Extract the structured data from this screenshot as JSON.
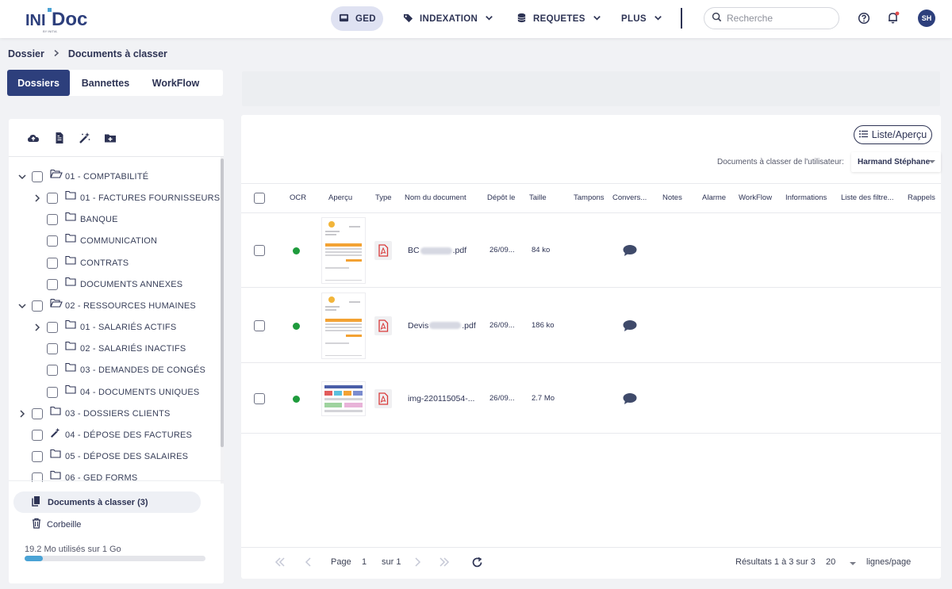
{
  "app": {
    "logo_text": "INITDoc",
    "logo_sub": "BY INITIA"
  },
  "nav": {
    "items": [
      {
        "label": "GED",
        "icon": "tray-icon",
        "active": true
      },
      {
        "label": "INDEXATION",
        "icon": "tag-icon",
        "active": false
      },
      {
        "label": "REQUETES",
        "icon": "database-icon",
        "active": false
      },
      {
        "label": "PLUS",
        "icon": "",
        "active": false
      }
    ],
    "search_placeholder": "Recherche",
    "avatar_initials": "SH"
  },
  "breadcrumb": {
    "root": "Dossier",
    "current": "Documents à classer"
  },
  "tabs": [
    "Dossiers",
    "Bannettes",
    "WorkFlow"
  ],
  "tree": [
    {
      "label": "01 - COMPTABILITÉ",
      "level": 0,
      "chevron": "down",
      "icon": "folder-open-icon"
    },
    {
      "label": "01 - FACTURES FOURNISSEURS",
      "level": 1,
      "chevron": "right",
      "icon": "folder-icon"
    },
    {
      "label": "BANQUE",
      "level": 1,
      "chevron": "",
      "icon": "folder-icon"
    },
    {
      "label": "COMMUNICATION",
      "level": 1,
      "chevron": "",
      "icon": "folder-icon"
    },
    {
      "label": "CONTRATS",
      "level": 1,
      "chevron": "",
      "icon": "folder-icon"
    },
    {
      "label": "DOCUMENTS ANNEXES",
      "level": 1,
      "chevron": "",
      "icon": "folder-icon"
    },
    {
      "label": "02 - RESSOURCES HUMAINES",
      "level": 0,
      "chevron": "down",
      "icon": "folder-open-icon"
    },
    {
      "label": "01 - SALARIÉS ACTIFS",
      "level": 1,
      "chevron": "right",
      "icon": "folder-icon"
    },
    {
      "label": "02 - SALARIÉS INACTIFS",
      "level": 1,
      "chevron": "",
      "icon": "folder-icon"
    },
    {
      "label": "03 - DEMANDES DE CONGÉS",
      "level": 1,
      "chevron": "",
      "icon": "folder-icon"
    },
    {
      "label": "04 - DOCUMENTS UNIQUES",
      "level": 1,
      "chevron": "",
      "icon": "folder-icon"
    },
    {
      "label": "03 - DOSSIERS CLIENTS",
      "level": 0,
      "chevron": "right",
      "icon": "folder-icon"
    },
    {
      "label": "04 - DÉPOSE DES FACTURES",
      "level": 0,
      "chevron": "",
      "icon": "magic-wand-icon"
    },
    {
      "label": "05 - DÉPOSE DES SALAIRES",
      "level": 0,
      "chevron": "",
      "icon": "folder-icon"
    },
    {
      "label": "06 - GED FORMS",
      "level": 0,
      "chevron": "",
      "icon": "folder-icon"
    }
  ],
  "sidebar_bottom": {
    "documents_label": "Documents à classer (3)",
    "trash_label": "Corbeille",
    "usage_text": "19.2 Mo utilisés sur 1 Go",
    "usage_fraction": 0.1
  },
  "main": {
    "view_toggle_label": "Liste/Aperçu",
    "user_filter_label": "Documents à classer de l'utilisateur:",
    "user_selected": "Harmand Stéphane",
    "columns": [
      "OCR",
      "Aperçu",
      "Type",
      "Nom du document",
      "Dépôt le",
      "Taille",
      "Tampons",
      "Convers...",
      "Notes",
      "Alarme",
      "WorkFlow",
      "Informations",
      "Liste des filtre...",
      "Rappels"
    ],
    "rows": [
      {
        "name_prefix": "BC",
        "name_suffix": ".pdf",
        "redacted": true,
        "date": "26/09...",
        "size": "84 ko"
      },
      {
        "name_prefix": "Devis",
        "name_suffix": ".pdf",
        "redacted": true,
        "date": "26/09...",
        "size": "186 ko"
      },
      {
        "name_prefix": "img-220115054-...",
        "name_suffix": "",
        "redacted": false,
        "date": "26/09...",
        "size": "2.7 Mo"
      }
    ]
  },
  "pagination": {
    "page_label": "Page",
    "page_value": "1",
    "of_label": "sur 1",
    "results_text": "Résultats 1 à 3 sur 3",
    "per_page_value": "20",
    "per_page_label": "lignes/page"
  },
  "colors": {
    "primary": "#2d3f7c",
    "ocr_ok": "#1e9b3c",
    "pdf": "#d93a3a",
    "usage": "#4aa3d5"
  }
}
